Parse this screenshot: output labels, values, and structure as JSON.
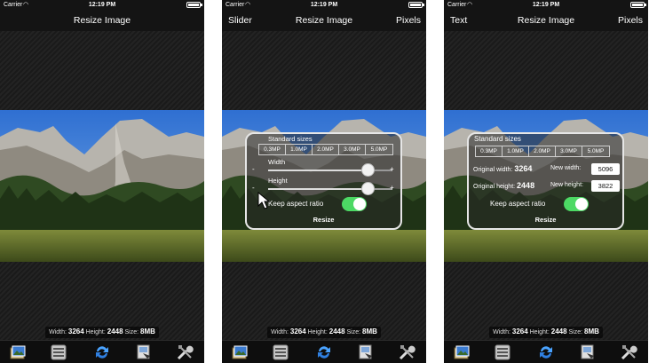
{
  "status": {
    "carrier": "Carrier",
    "time": "12:19 PM"
  },
  "screens": [
    {
      "nav": {
        "left": "",
        "title": "Resize Image",
        "right": ""
      }
    },
    {
      "nav": {
        "left": "Slider",
        "title": "Resize Image",
        "right": "Pixels"
      }
    },
    {
      "nav": {
        "left": "Text",
        "title": "Resize Image",
        "right": "Pixels"
      }
    }
  ],
  "info": {
    "width_label": "Width:",
    "width": "3264",
    "height_label": "Height:",
    "height": "2448",
    "size_label": "Size:",
    "size": "8MB"
  },
  "panel": {
    "title": "Standard sizes",
    "sizes": [
      "0.3MP",
      "1.0MP",
      "2.0MP",
      "3.0MP",
      "5.0MP"
    ],
    "width_label": "Width",
    "height_label": "Height",
    "minus": "-",
    "plus": "+",
    "width_slider": 0.8,
    "height_slider": 0.8,
    "aspect_label": "Keep aspect ratio",
    "aspect_on": true,
    "resize_label": "Resize",
    "orig_width_label": "Original width:",
    "orig_width": "3264",
    "new_width_label": "New width:",
    "new_width": "5096",
    "orig_height_label": "Original height:",
    "orig_height": "2448",
    "new_height_label": "New height:",
    "new_height": "3822"
  },
  "toolbar_icons": [
    "photo-library-icon",
    "settings-list-icon",
    "refresh-icon",
    "save-icon",
    "tools-icon"
  ],
  "colors": {
    "toggle_on": "#4cd964",
    "background": "#141414"
  }
}
